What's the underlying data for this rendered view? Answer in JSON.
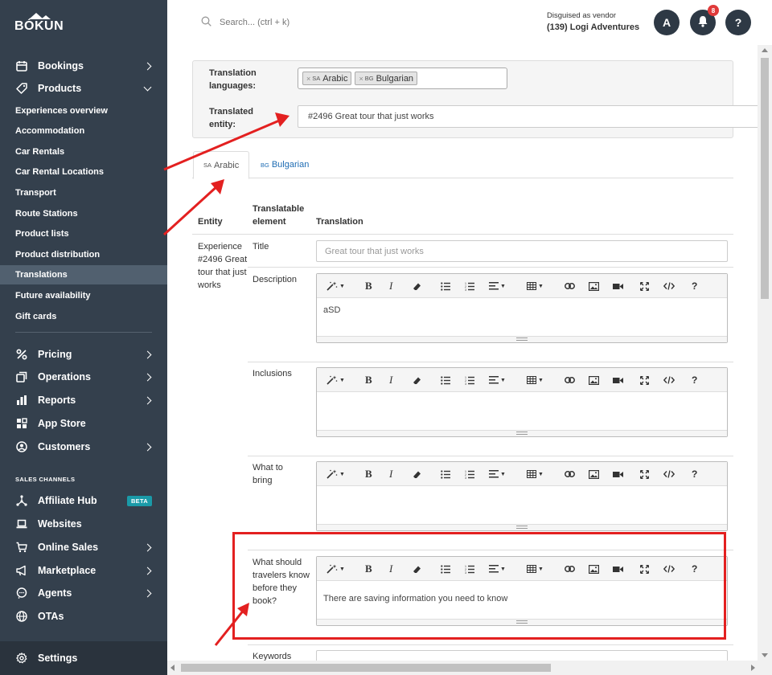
{
  "brand": {
    "name": "BÓKUN"
  },
  "sidebar": {
    "main_items": [
      {
        "label": "Bookings"
      },
      {
        "label": "Products"
      }
    ],
    "product_subitems": [
      {
        "label": "Experiences overview"
      },
      {
        "label": "Accommodation"
      },
      {
        "label": "Car Rentals"
      },
      {
        "label": "Car Rental Locations"
      },
      {
        "label": "Transport"
      },
      {
        "label": "Route Stations"
      },
      {
        "label": "Product lists"
      },
      {
        "label": "Product distribution"
      },
      {
        "label": "Translations"
      },
      {
        "label": "Future availability"
      },
      {
        "label": "Gift cards"
      }
    ],
    "lower_items": [
      {
        "label": "Pricing"
      },
      {
        "label": "Operations"
      },
      {
        "label": "Reports"
      },
      {
        "label": "App Store"
      },
      {
        "label": "Customers"
      }
    ],
    "sales_channels_label": "SALES CHANNELS",
    "sales_items": [
      {
        "label": "Affiliate Hub",
        "badge": "BETA"
      },
      {
        "label": "Websites"
      },
      {
        "label": "Online Sales"
      },
      {
        "label": "Marketplace"
      },
      {
        "label": "Agents"
      },
      {
        "label": "OTAs"
      }
    ],
    "settings_label": "Settings",
    "active_item": "Translations"
  },
  "header": {
    "search_placeholder": "Search... (ctrl + k)",
    "vendor_caption": "Disguised as vendor",
    "vendor_name": "(139) Logi Adventures",
    "avatar_letter": "A",
    "notification_count": "8",
    "help_label": "?"
  },
  "filters": {
    "languages_label": "Translation languages:",
    "languages": [
      {
        "code": "SA",
        "name": "Arabic"
      },
      {
        "code": "BG",
        "name": "Bulgarian"
      }
    ],
    "entity_label": "Translated entity:",
    "entity_value": "#2496 Great tour that just works"
  },
  "tabs": [
    {
      "code": "SA",
      "label": "Arabic",
      "active": true
    },
    {
      "code": "BG",
      "label": "Bulgarian",
      "active": false
    }
  ],
  "table": {
    "headers": {
      "entity": "Entity",
      "element": "Translatable element",
      "translation": "Translation"
    },
    "entity_cell": "Experience #2496 Great tour that just works",
    "rows": [
      {
        "element": "Title",
        "placeholder": "Great tour that just works"
      },
      {
        "element": "Description",
        "content": "aSD"
      },
      {
        "element": "Inclusions",
        "content": ""
      },
      {
        "element": "What to bring",
        "content": ""
      },
      {
        "element": "What should travelers know before they book?",
        "content": "There are saving information you need to know"
      },
      {
        "element": "Keywords"
      }
    ]
  },
  "toolbar_icons": [
    "magic-icon",
    "bold-icon",
    "italic-icon",
    "eraser-icon",
    "bullet-list-icon",
    "numbered-list-icon",
    "align-icon",
    "table-icon",
    "link-icon",
    "image-icon",
    "video-icon",
    "fullscreen-icon",
    "code-view-icon",
    "help-icon"
  ],
  "colors": {
    "sidebar_bg": "#34404d",
    "active_item_bg": "#51606f",
    "accent_link": "#1e6cb3",
    "annotation_red": "#e32020",
    "beta_badge": "#1a9aa8",
    "badge_red": "#e03a3a"
  }
}
